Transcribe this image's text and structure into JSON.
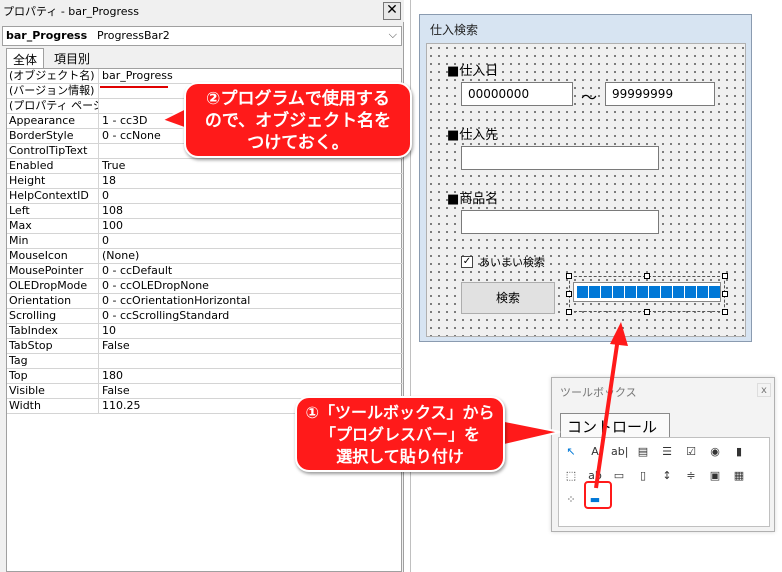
{
  "properties_window": {
    "title": "プロパティ - bar_Progress",
    "close_glyph": "✕",
    "object_name": "bar_Progress",
    "object_type": "ProgressBar2",
    "tabs": [
      "全体",
      "項目別"
    ],
    "rows": [
      {
        "key": "(オブジェクト名)",
        "value": "bar_Progress"
      },
      {
        "key": "(バージョン情報)",
        "value": ""
      },
      {
        "key": "(プロパティ ページ)",
        "value": ""
      },
      {
        "key": "Appearance",
        "value": "1 - cc3D"
      },
      {
        "key": "BorderStyle",
        "value": "0 - ccNone"
      },
      {
        "key": "ControlTipText",
        "value": ""
      },
      {
        "key": "Enabled",
        "value": "True"
      },
      {
        "key": "Height",
        "value": "18"
      },
      {
        "key": "HelpContextID",
        "value": "0"
      },
      {
        "key": "Left",
        "value": "108"
      },
      {
        "key": "Max",
        "value": "100"
      },
      {
        "key": "Min",
        "value": "0"
      },
      {
        "key": "MouseIcon",
        "value": "(None)"
      },
      {
        "key": "MousePointer",
        "value": "0 - ccDefault"
      },
      {
        "key": "OLEDropMode",
        "value": "0 - ccOLEDropNone"
      },
      {
        "key": "Orientation",
        "value": "0 - ccOrientationHorizontal"
      },
      {
        "key": "Scrolling",
        "value": "0 - ccScrollingStandard"
      },
      {
        "key": "TabIndex",
        "value": "10"
      },
      {
        "key": "TabStop",
        "value": "False"
      },
      {
        "key": "Tag",
        "value": ""
      },
      {
        "key": "Top",
        "value": "180"
      },
      {
        "key": "Visible",
        "value": "False"
      },
      {
        "key": "Width",
        "value": "110.25"
      }
    ]
  },
  "callouts": {
    "program_name": {
      "lines": [
        "②プログラムで使用する",
        "ので、オブジェクト名を",
        "つけておく。"
      ],
      "color": "#ff1a1a"
    },
    "toolbox_pick": {
      "lines": [
        "①「ツールボックス」から",
        "「プログレスバー」を",
        "選択して貼り付け"
      ],
      "color": "#ff1a1a"
    }
  },
  "userform": {
    "title": "仕入検索",
    "purchase_date_label": "■仕入日",
    "date_from": "00000000",
    "tilde": "～",
    "date_to": "99999999",
    "supplier_label": "■仕入先",
    "product_label": "■商品名",
    "fuzzy_checkbox_label": "あいまい検索",
    "fuzzy_checked": true,
    "search_button": "検索",
    "progress": {
      "segments": 12,
      "color": "#0078d7"
    }
  },
  "toolbox": {
    "title": "ツールボックス",
    "close_glyph": "x",
    "tab": "コントロール",
    "tools": [
      {
        "name": "pointer-icon",
        "glyph": "↖"
      },
      {
        "name": "label-icon",
        "glyph": "A"
      },
      {
        "name": "textbox-icon",
        "glyph": "ab|"
      },
      {
        "name": "combobox-icon",
        "glyph": "▤"
      },
      {
        "name": "listbox-icon",
        "glyph": "☰"
      },
      {
        "name": "checkbox-icon",
        "glyph": "☑"
      },
      {
        "name": "optionbutton-icon",
        "glyph": "◉"
      },
      {
        "name": "togglebutton-icon",
        "glyph": "▮"
      },
      {
        "name": "frame-icon",
        "glyph": "⬚"
      },
      {
        "name": "commandbutton-icon",
        "glyph": "ab"
      },
      {
        "name": "tabstrip-icon",
        "glyph": "▭"
      },
      {
        "name": "multipage-icon",
        "glyph": "▯"
      },
      {
        "name": "scrollbar-icon",
        "glyph": "↕"
      },
      {
        "name": "spinbutton-icon",
        "glyph": "≑"
      },
      {
        "name": "image-icon",
        "glyph": "▣"
      },
      {
        "name": "refedit-icon",
        "glyph": "▦"
      },
      {
        "name": "treeview-icon",
        "glyph": "⁘"
      },
      {
        "name": "progressbar-icon",
        "glyph": "▬"
      }
    ],
    "accent": "#0078d7"
  }
}
